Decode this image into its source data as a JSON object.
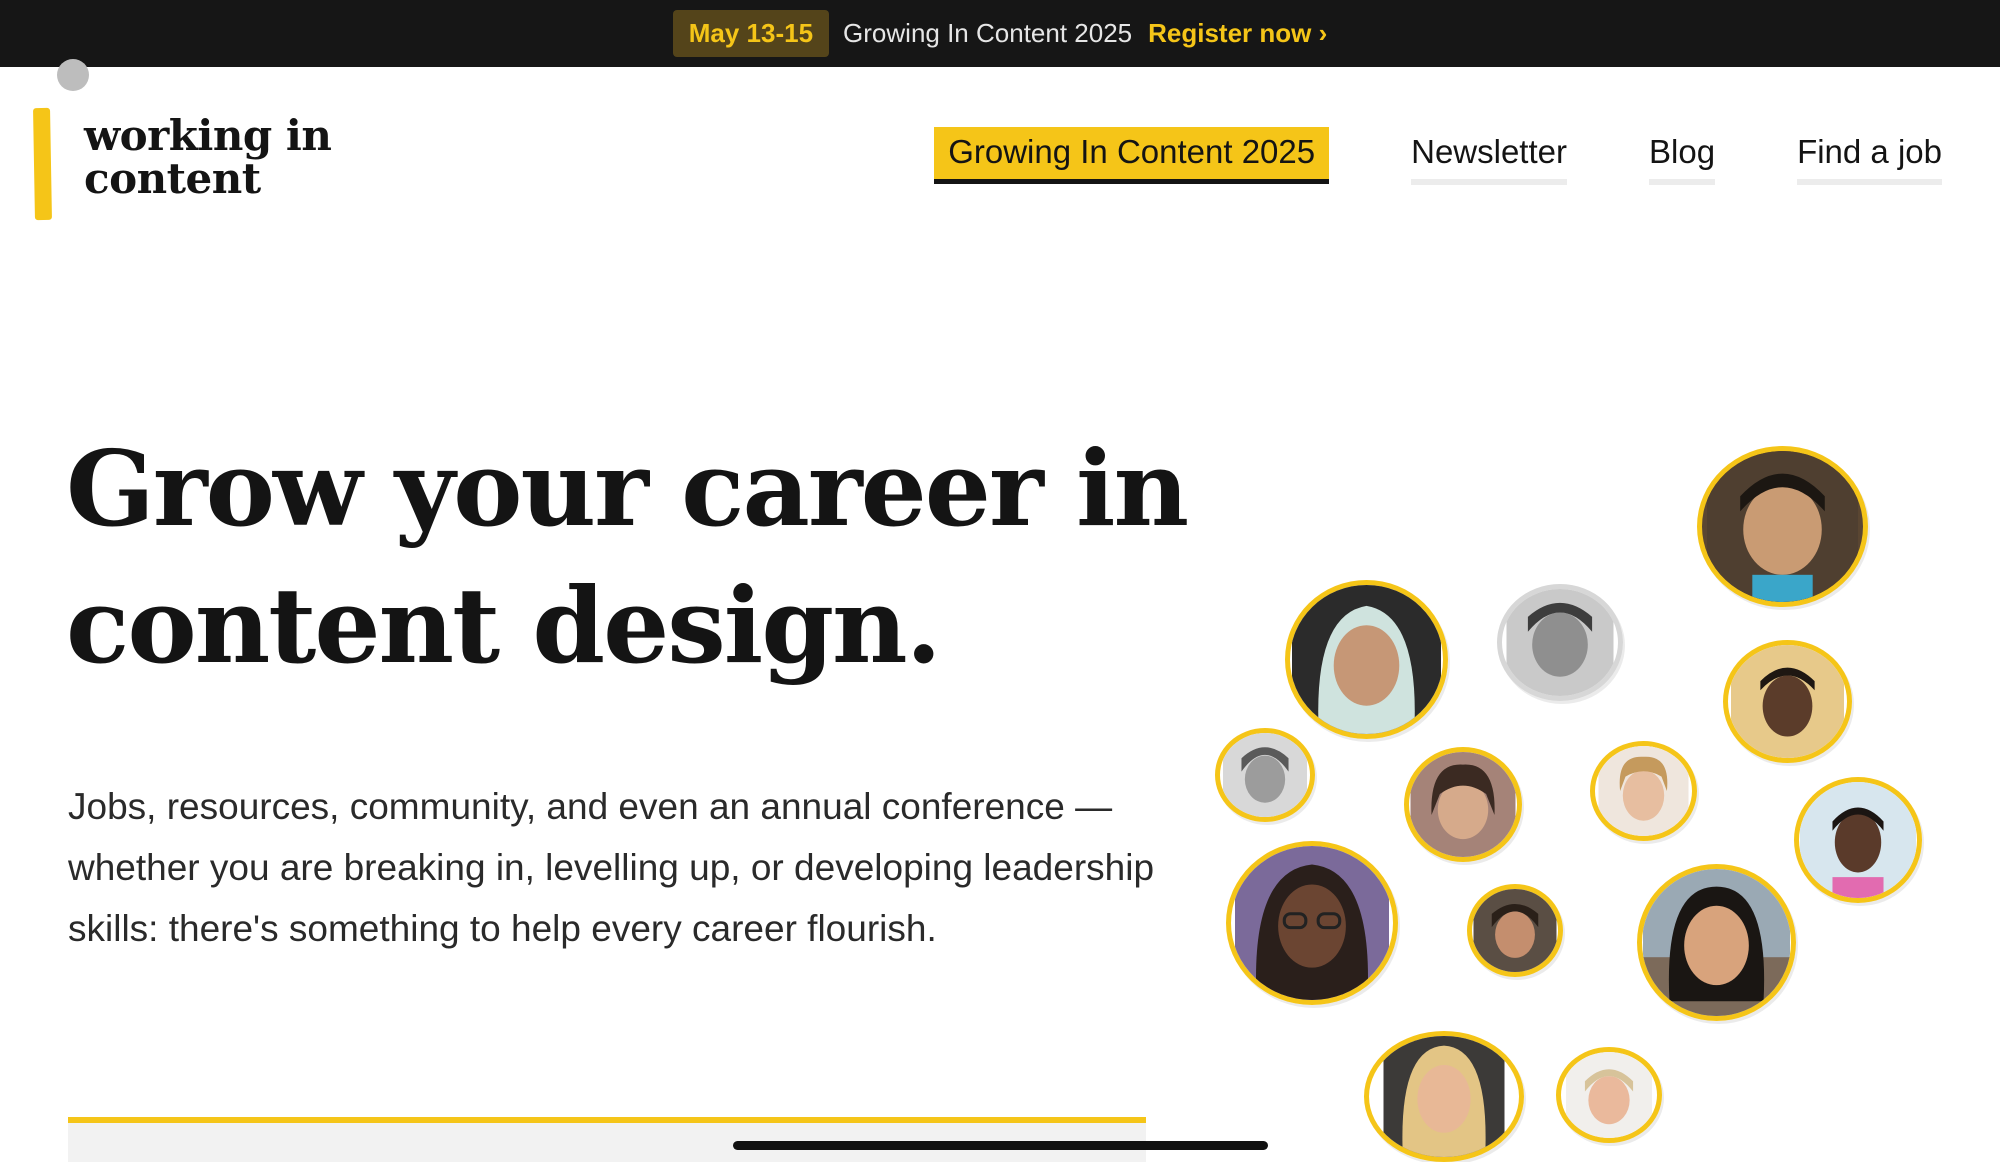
{
  "banner": {
    "date": "May 13-15",
    "event": "Growing In Content 2025",
    "cta": "Register now ›"
  },
  "logo": {
    "line1": "working in",
    "line2": "content"
  },
  "nav": {
    "items": [
      {
        "label": "Growing In Content 2025",
        "active": true
      },
      {
        "label": "Newsletter"
      },
      {
        "label": "Blog"
      },
      {
        "label": "Find a job"
      }
    ]
  },
  "hero": {
    "title_line1": "Grow your career in",
    "title_line2": "content design.",
    "description": "Jobs, resources, community, and even an annual conference — whether you are breaking in, levelling up, or developing leadership skills: there's something to help every career flourish."
  },
  "colors": {
    "accent": "#f5c518",
    "banner_bg": "#161616",
    "text": "#141414"
  }
}
